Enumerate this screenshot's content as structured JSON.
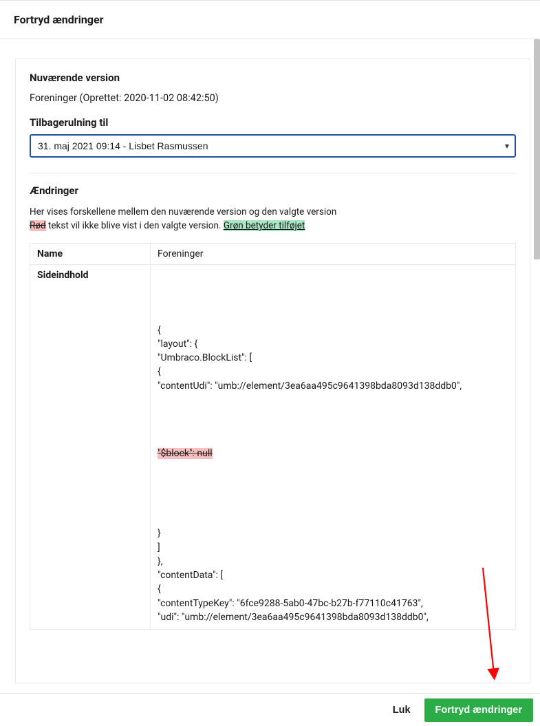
{
  "header": {
    "title": "Fortryd ændringer"
  },
  "current": {
    "label": "Nuværende version",
    "meta": "Foreninger (Oprettet: 2020-11-02 08:42:50)"
  },
  "rollback": {
    "label": "Tilbagerulning til",
    "selected": "31. maj 2021 09:14 - Lisbet Rasmussen"
  },
  "changes": {
    "title": "Ændringer",
    "info": "Her vises forskellene mellem den nuværende version og den valgte version",
    "red_word": "Rød",
    "middle_text": " tekst vil ikke blive vist i den valgte version. ",
    "green_word": "Grøn betyder tilføjet"
  },
  "table": {
    "row1_label": "Name",
    "row1_value": "Foreninger",
    "row2_label": "Sideindhold"
  },
  "diff": {
    "l1": "{",
    "l2": "\"layout\": {",
    "l3": "\"Umbraco.BlockList\": [",
    "l4": "{",
    "l5": "\"contentUdi\": \"umb://element/3ea6aa495c9641398bda8093d138ddb0\",",
    "removed": "\"$block\": null",
    "l6": "}",
    "l7": "]",
    "l8": "},",
    "l9": "\"contentData\": [",
    "l10": "{",
    "l11": "\"contentTypeKey\": \"6fce9288-5ab0-47bc-b27b-f77110c41763\",",
    "l12": "\"udi\": \"umb://element/3ea6aa495c9641398bda8093d138ddb0\","
  },
  "footer": {
    "close": "Luk",
    "confirm": "Fortryd ændringer"
  },
  "colors": {
    "primary_green": "#2bac47",
    "select_border": "#2152a3",
    "del_bg": "#f8bdbd",
    "ins_bg": "#a7e6c4",
    "arrow": "#ff0000"
  }
}
